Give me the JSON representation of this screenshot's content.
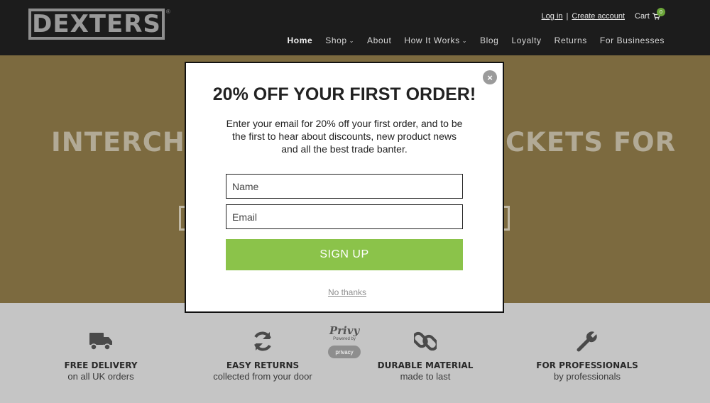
{
  "header": {
    "logo_text": "DEXTERS",
    "logo_reg": "®",
    "login_label": "Log in",
    "separator": "|",
    "create_account_label": "Create account",
    "cart_label": "Cart",
    "cart_count": "0"
  },
  "nav": {
    "items": [
      {
        "label": "Home",
        "active": true
      },
      {
        "label": "Shop",
        "dropdown": true
      },
      {
        "label": "About"
      },
      {
        "label": "How It Works",
        "dropdown": true
      },
      {
        "label": "Blog"
      },
      {
        "label": "Loyalty"
      },
      {
        "label": "Returns"
      },
      {
        "label": "For Businesses"
      }
    ]
  },
  "hero": {
    "title_left_visible": "INTERCHA",
    "title_right_visible": "CKETS FOR"
  },
  "popup": {
    "title": "20% OFF YOUR FIRST ORDER!",
    "body": "Enter your email for 20% off your first order, and to be the first to hear about discounts, new product news and all the best trade banter.",
    "name_placeholder": "Name",
    "email_placeholder": "Email",
    "signup_label": "SIGN UP",
    "no_thanks_label": "No thanks",
    "close_icon": "×"
  },
  "features": [
    {
      "icon": "truck-icon",
      "title": "FREE DELIVERY",
      "subtitle": "on all UK orders"
    },
    {
      "icon": "refresh-icon",
      "title": "EASY RETURNS",
      "subtitle": "collected from your door"
    },
    {
      "icon": "chain-link-icon",
      "title": "DURABLE MATERIAL",
      "subtitle": "made to last"
    },
    {
      "icon": "wrench-icon",
      "title": "FOR PROFESSIONALS",
      "subtitle": "by professionals"
    }
  ],
  "privy": {
    "logo_text": "Privy",
    "powered_by": "Powered by",
    "privacy_label": "privacy"
  },
  "colors": {
    "header_bg": "#1c1c1c",
    "hero_bg": "#7c6a3f",
    "features_bg": "#c5c5c5",
    "signup_green": "#8bc34a",
    "cart_badge": "#6ba539"
  }
}
